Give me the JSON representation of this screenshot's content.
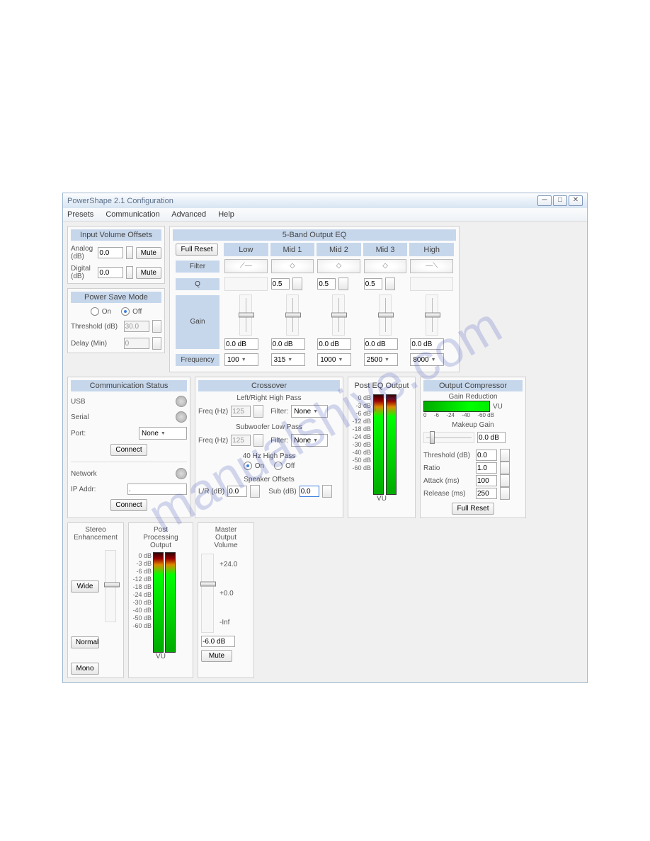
{
  "title": "PowerShape 2.1 Configuration",
  "menu": {
    "i0": "Presets",
    "i1": "Communication",
    "i2": "Advanced",
    "i3": "Help"
  },
  "ivo": {
    "hdr": "Input Volume Offsets",
    "analog": "Analog (dB)",
    "av": "0.0",
    "digital": "Digital (dB)",
    "dv": "0.0",
    "mute": "Mute"
  },
  "psm": {
    "hdr": "Power Save Mode",
    "on": "On",
    "off": "Off",
    "thresh": "Threshold (dB)",
    "tv": "30.0",
    "delay": "Delay (Min)",
    "dv": "0"
  },
  "eq": {
    "hdr": "5-Band Output EQ",
    "reset": "Full Reset",
    "filter": "Filter",
    "q": "Q",
    "gain": "Gain",
    "freq": "Frequency",
    "b0": "Low",
    "b1": "Mid 1",
    "b2": "Mid 2",
    "b3": "Mid 3",
    "b4": "High",
    "q1": "0.5",
    "q2": "0.5",
    "q3": "0.5",
    "g0": "0.0 dB",
    "g1": "0.0 dB",
    "g2": "0.0 dB",
    "g3": "0.0 dB",
    "g4": "0.0 dB",
    "f0": "100",
    "f1": "315",
    "f2": "1000",
    "f3": "2500",
    "f4": "8000"
  },
  "cs": {
    "hdr": "Communication Status",
    "usb": "USB",
    "serial": "Serial",
    "port": "Port:",
    "pv": "None",
    "net": "Network",
    "ip": "IP Addr:",
    "connect": "Connect"
  },
  "xo": {
    "hdr": "Crossover",
    "lrhp": "Left/Right High Pass",
    "freq": "Freq (Hz)",
    "fv": "125",
    "filter": "Filter:",
    "flt": "None",
    "slp": "Subwoofer Low Pass",
    "hz40": "40 Hz High Pass",
    "on": "On",
    "off": "Off",
    "spk": "Speaker Offsets",
    "lr": "L/R (dB)",
    "lrv": "0.0",
    "sub": "Sub (dB)",
    "sv": "0.0"
  },
  "peq": {
    "hdr": "Post EQ Output",
    "l0": "0 dB",
    "l1": "-3 dB",
    "l2": "-6 dB",
    "l3": "-12 dB",
    "l4": "-18 dB",
    "l5": "-24 dB",
    "l6": "-30 dB",
    "l7": "-40 dB",
    "l8": "-50 dB",
    "l9": "-60 dB",
    "vu": "VU"
  },
  "oc": {
    "hdr": "Output Compressor",
    "gr": "Gain Reduction",
    "vu": "VU",
    "t0": "0",
    "t1": "-6",
    "t2": "-24",
    "t3": "-40",
    "t4": "-60 dB",
    "mg": "Makeup Gain",
    "mgv": "0.0 dB",
    "th": "Threshold (dB)",
    "thv": "0.0",
    "ra": "Ratio",
    "rav": "1.0",
    "at": "Attack (ms)",
    "atv": "100",
    "re": "Release (ms)",
    "rev": "250",
    "reset": "Full Reset"
  },
  "se": {
    "hdr": "Stereo\nEnhancement",
    "wide": "Wide",
    "norm": "Normal",
    "mono": "Mono"
  },
  "ppo": {
    "hdr": "Post\nProcessing\nOutput"
  },
  "mov": {
    "hdr": "Master\nOutput\nVolume",
    "hi": "+24.0",
    "mid": "+0.0",
    "lo": "-Inf",
    "v": "-6.0 dB",
    "mute": "Mute"
  }
}
